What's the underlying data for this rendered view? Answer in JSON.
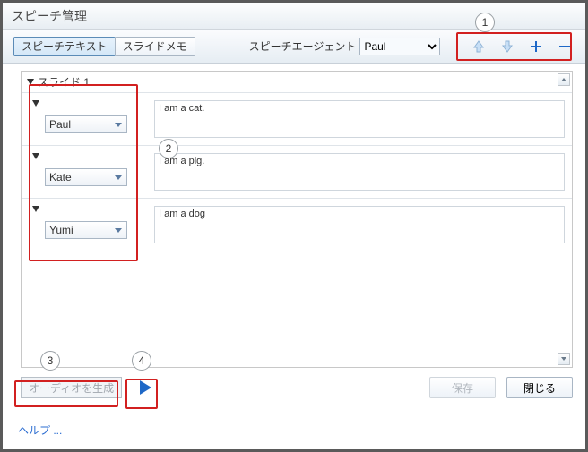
{
  "window": {
    "title": "スピーチ管理"
  },
  "toolbar": {
    "tabs": [
      {
        "label": "スピーチテキスト",
        "active": true
      },
      {
        "label": "スライドメモ",
        "active": false
      }
    ],
    "agent_label": "スピーチエージェント",
    "agent_value": "Paul",
    "icons": [
      "arrow-up",
      "arrow-down",
      "plus",
      "minus"
    ]
  },
  "slide": {
    "title": "スライド 1",
    "rows": [
      {
        "agent": "Paul",
        "text": "I am a cat."
      },
      {
        "agent": "Kate",
        "text": "I am a pig."
      },
      {
        "agent": "Yumi",
        "text": "I am a dog"
      }
    ]
  },
  "footer": {
    "generate_label": "オーディオを生成",
    "help_label": "ヘルプ ...",
    "save_label": "保存",
    "close_label": "閉じる"
  },
  "callouts": {
    "n1": "1",
    "n2": "2",
    "n3": "3",
    "n4": "4"
  }
}
